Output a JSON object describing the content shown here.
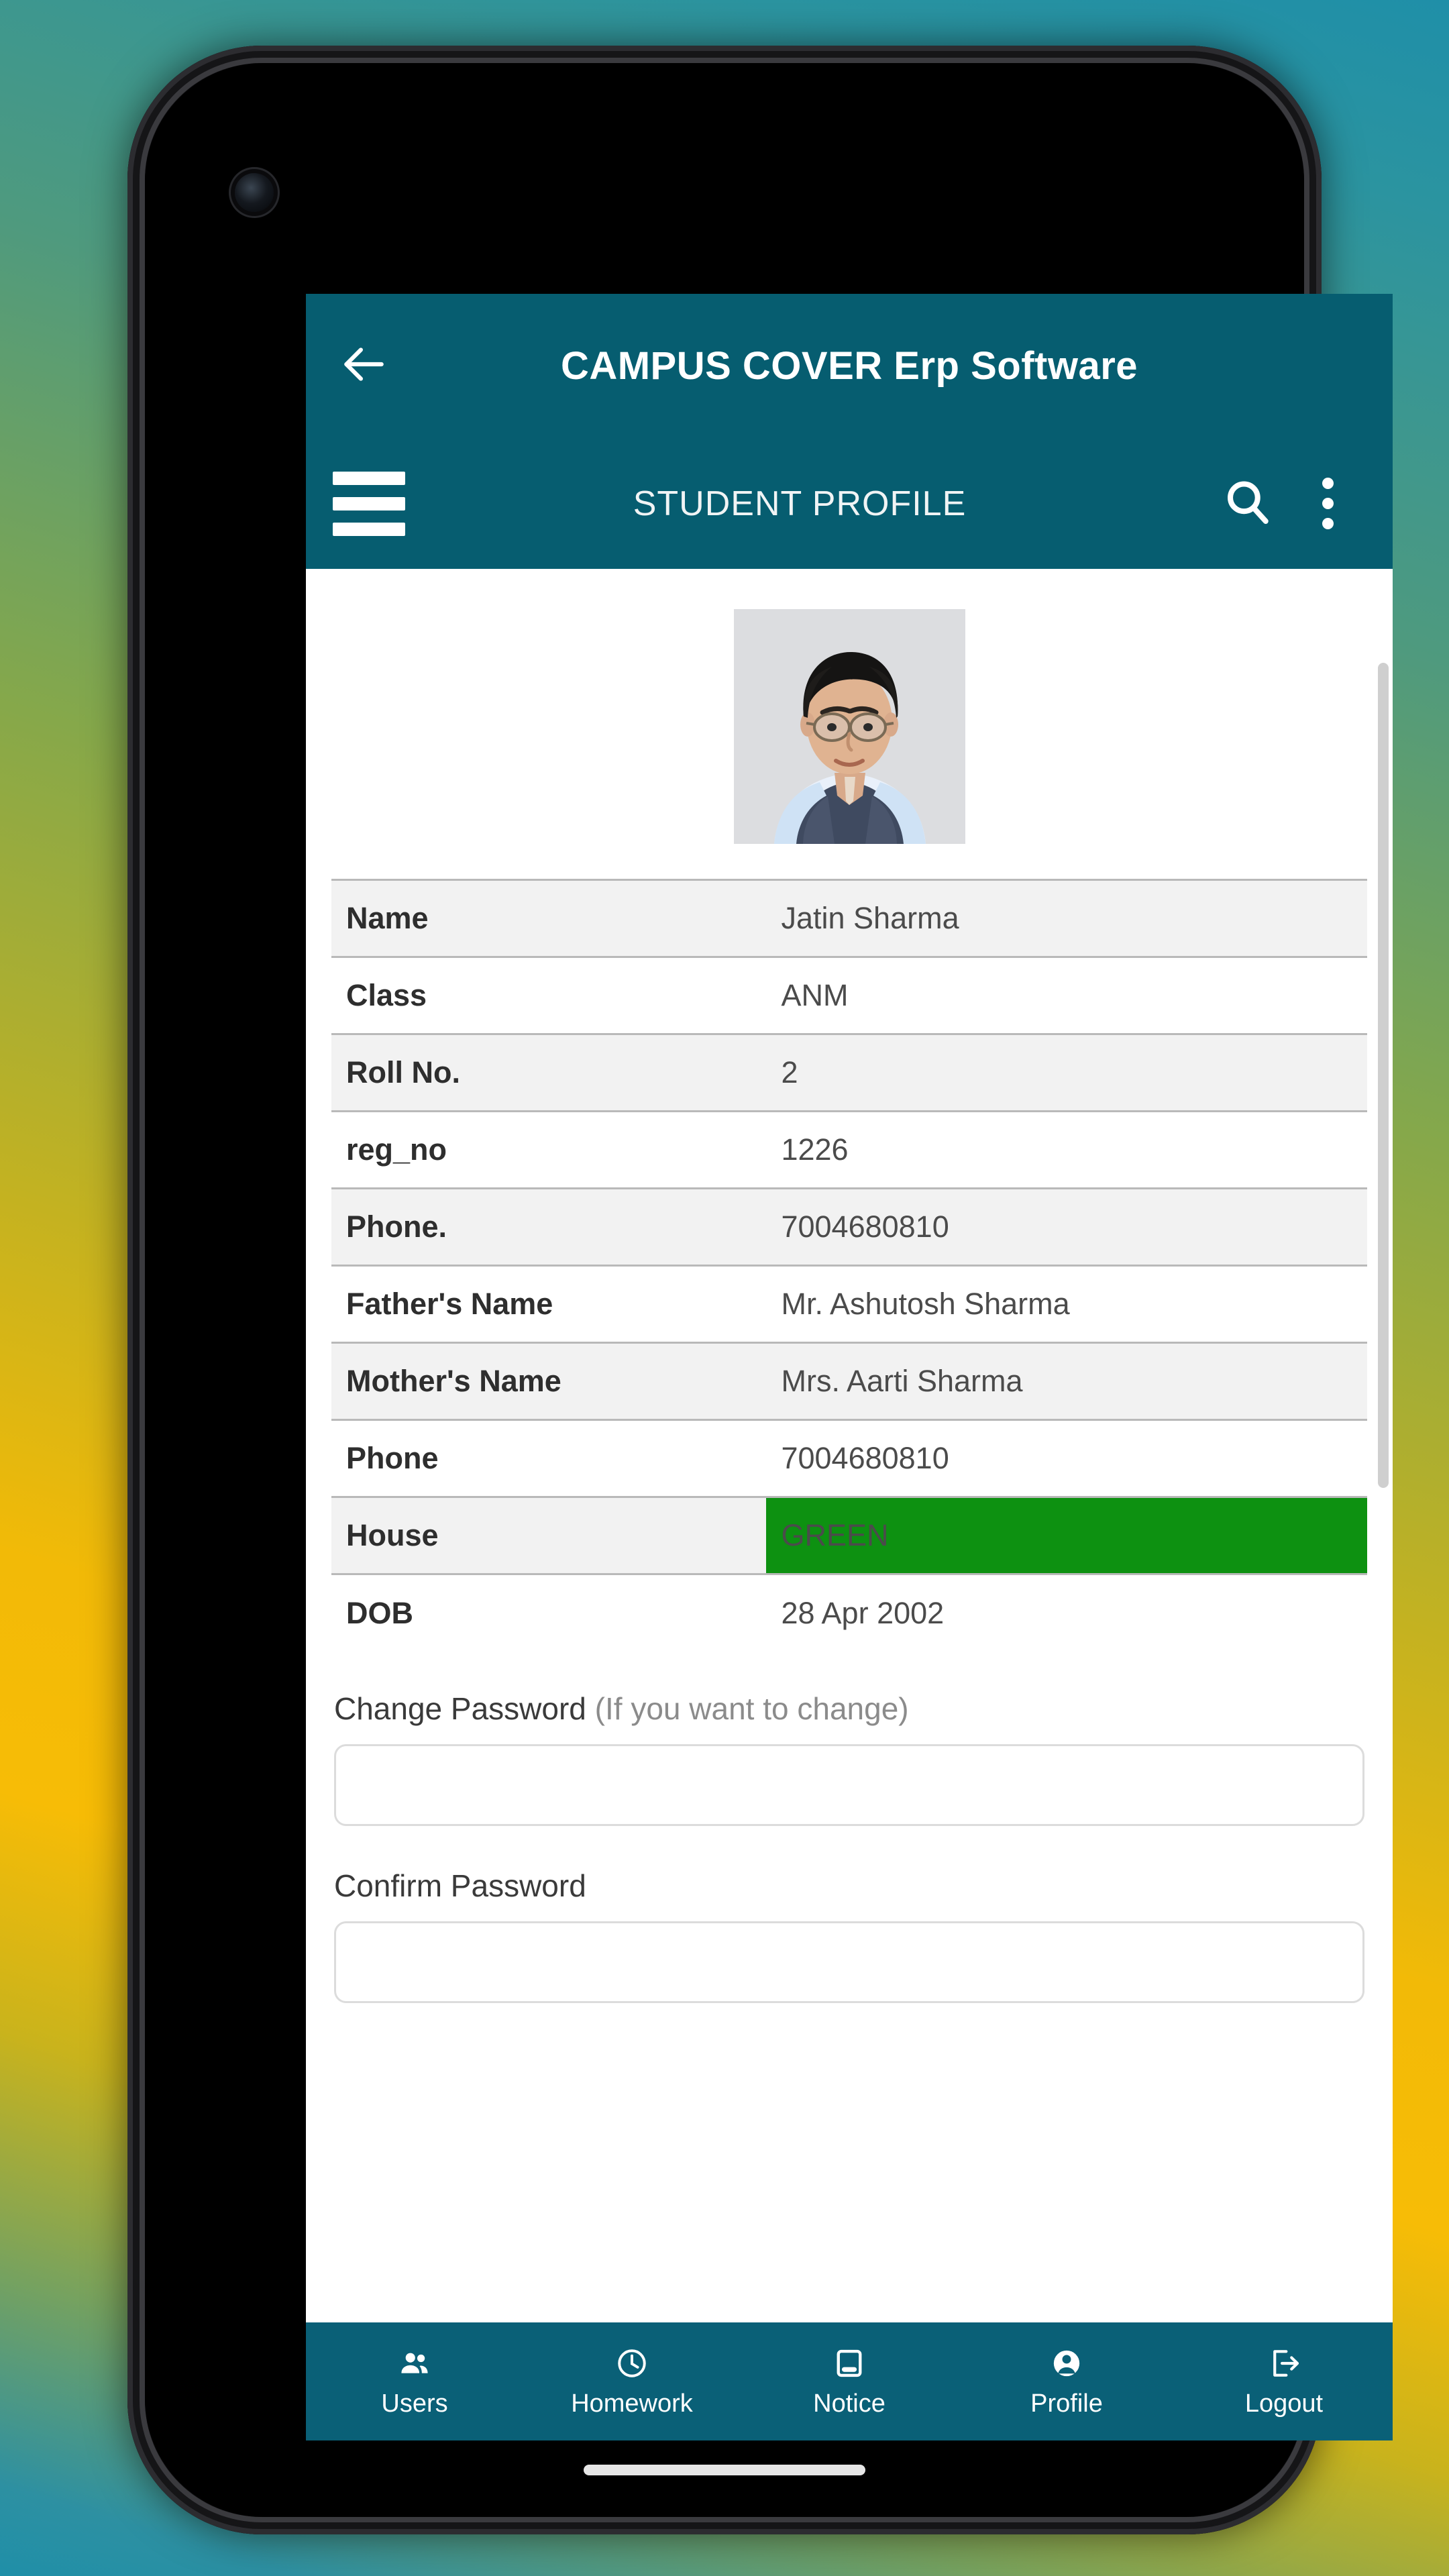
{
  "appbar": {
    "title": "CAMPUS COVER Erp Software",
    "screen_title": "STUDENT PROFILE",
    "back_icon": "arrow-left-icon",
    "menu_icon": "hamburger-menu-icon",
    "search_icon": "search-icon",
    "overflow_icon": "more-vertical-icon",
    "background_color": "#065d70"
  },
  "profile": {
    "photo_alt": "student-portrait",
    "rows": [
      {
        "label": "Name",
        "value": "Jatin Sharma"
      },
      {
        "label": "Class",
        "value": "ANM"
      },
      {
        "label": "Roll No.",
        "value": "2"
      },
      {
        "label": "reg_no",
        "value": "1226"
      },
      {
        "label": "Phone.",
        "value": "7004680810"
      },
      {
        "label": "Father's Name",
        "value": "Mr. Ashutosh Sharma"
      },
      {
        "label": "Mother's Name",
        "value": "Mrs. Aarti Sharma"
      },
      {
        "label": "Phone",
        "value": "7004680810"
      },
      {
        "label": "House",
        "value": "GREEN"
      },
      {
        "label": "DOB",
        "value": "28 Apr 2002"
      }
    ],
    "house_color": "#0d9111"
  },
  "form": {
    "change_password_label": "Change Password ",
    "change_password_hint": "(If you want to change)",
    "change_password_value": "",
    "change_password_placeholder": "",
    "confirm_password_label": "Confirm Password",
    "confirm_password_value": "",
    "confirm_password_placeholder": ""
  },
  "bottom_nav": {
    "background_color": "#0a6077",
    "items": [
      {
        "label": "Users",
        "icon": "people-icon"
      },
      {
        "label": "Homework",
        "icon": "clock-icon"
      },
      {
        "label": "Notice",
        "icon": "notice-board-icon"
      },
      {
        "label": "Profile",
        "icon": "account-circle-icon"
      },
      {
        "label": "Logout",
        "icon": "logout-icon"
      }
    ]
  }
}
